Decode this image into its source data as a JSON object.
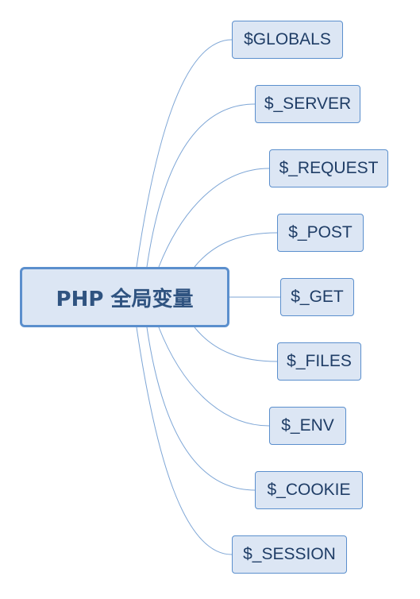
{
  "mindmap": {
    "root": {
      "label": "PHP 全局变量"
    },
    "children": [
      {
        "label": "$GLOBALS"
      },
      {
        "label": "$_SERVER"
      },
      {
        "label": "$_REQUEST"
      },
      {
        "label": "$_POST"
      },
      {
        "label": "$_GET"
      },
      {
        "label": "$_FILES"
      },
      {
        "label": "$_ENV"
      },
      {
        "label": "$_COOKIE"
      },
      {
        "label": "$_SESSION"
      }
    ]
  },
  "colors": {
    "node_fill": "#dce6f4",
    "node_border": "#5b8fcd",
    "root_text": "#2f5380",
    "child_text": "#1f3d66",
    "connector": "#7ea6d6"
  }
}
